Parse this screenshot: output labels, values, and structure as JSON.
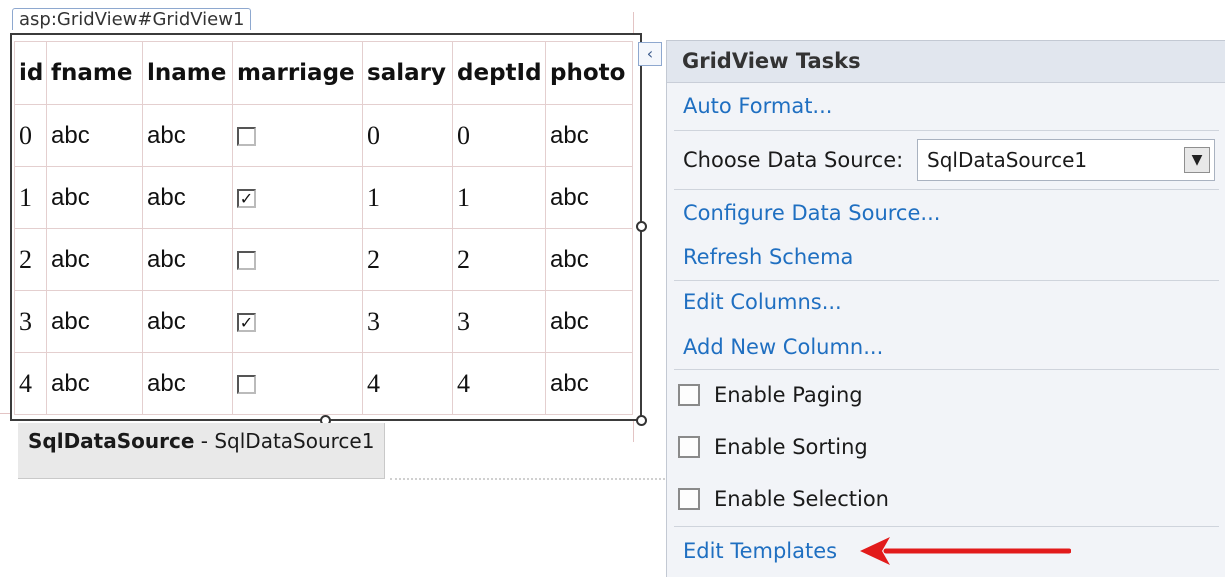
{
  "designer": {
    "gridview_tag": "asp:GridView#GridView1",
    "columns": [
      "id",
      "fname",
      "lname",
      "marriage",
      "salary",
      "deptId",
      "photo"
    ],
    "rows": [
      {
        "id": "0",
        "fname": "abc",
        "lname": "abc",
        "marriage": false,
        "salary": "0",
        "deptId": "0",
        "photo": "abc"
      },
      {
        "id": "1",
        "fname": "abc",
        "lname": "abc",
        "marriage": true,
        "salary": "1",
        "deptId": "1",
        "photo": "abc"
      },
      {
        "id": "2",
        "fname": "abc",
        "lname": "abc",
        "marriage": false,
        "salary": "2",
        "deptId": "2",
        "photo": "abc"
      },
      {
        "id": "3",
        "fname": "abc",
        "lname": "abc",
        "marriage": true,
        "salary": "3",
        "deptId": "3",
        "photo": "abc"
      },
      {
        "id": "4",
        "fname": "abc",
        "lname": "abc",
        "marriage": false,
        "salary": "4",
        "deptId": "4",
        "photo": "abc"
      }
    ],
    "datasource_control": {
      "type_label": "SqlDataSource",
      "separator": " - ",
      "id_label": "SqlDataSource1"
    },
    "smart_tag_icon": "chevron-left-icon"
  },
  "tasks": {
    "title": "GridView Tasks",
    "auto_format": "Auto Format...",
    "choose_data_source_label": "Choose Data Source:",
    "data_source_selected": "SqlDataSource1",
    "configure_data_source": "Configure Data Source...",
    "refresh_schema": "Refresh Schema",
    "edit_columns": "Edit Columns...",
    "add_new_column": "Add New Column...",
    "enable_paging": "Enable Paging",
    "enable_sorting": "Enable Sorting",
    "enable_selection": "Enable Selection",
    "enable_paging_checked": false,
    "enable_sorting_checked": false,
    "enable_selection_checked": false,
    "edit_templates": "Edit Templates"
  },
  "annotation": {
    "arrow_color": "#e21b1b",
    "arrow_icon": "arrow-left-icon"
  },
  "colors": {
    "link": "#1f6fc1",
    "panel_bg": "#f2f4f8",
    "panel_header_bg": "#e1e6ee",
    "grid_border": "#e4cfcf"
  }
}
